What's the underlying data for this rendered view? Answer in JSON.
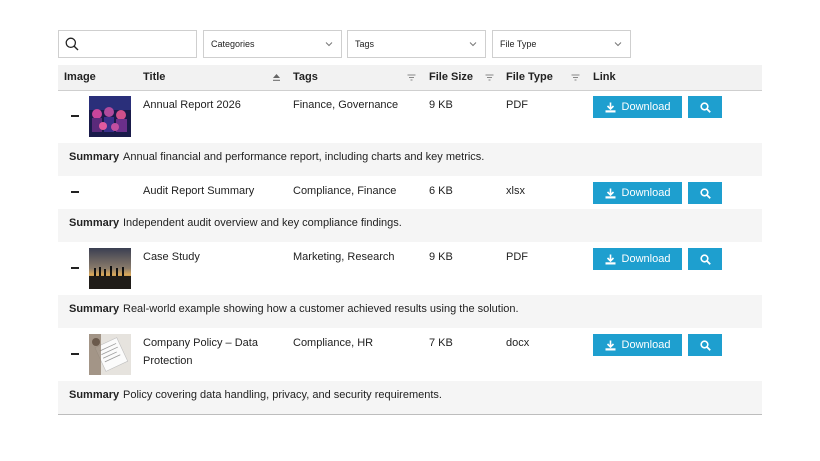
{
  "filters": {
    "search_placeholder": "",
    "categories_label": "Categories",
    "tags_label": "Tags",
    "file_type_label": "File Type"
  },
  "table": {
    "headers": {
      "image": "Image",
      "title": "Title",
      "tags": "Tags",
      "file_size": "File Size",
      "file_type": "File Type",
      "link": "Link"
    },
    "download_label": "Download",
    "summary_label": "Summary",
    "rows": [
      {
        "title": "Annual Report 2026",
        "tags": "Finance, Governance",
        "file_size": "9 KB",
        "file_type": "PDF",
        "has_image": true,
        "summary": "Annual financial and performance report, including charts and key metrics."
      },
      {
        "title": "Audit Report Summary",
        "tags": "Compliance, Finance",
        "file_size": "6 KB",
        "file_type": "xlsx",
        "has_image": false,
        "summary": "Independent audit overview and key compliance findings."
      },
      {
        "title": "Case Study",
        "tags": "Marketing, Research",
        "file_size": "9 KB",
        "file_type": "PDF",
        "has_image": true,
        "summary": "Real-world example showing how a customer achieved results using the solution."
      },
      {
        "title_line1": "Company Policy – Data",
        "title_line2": "Protection",
        "tags": "Compliance, HR",
        "file_size": "7 KB",
        "file_type": "docx",
        "has_image": true,
        "summary": "Policy covering data handling, privacy, and security requirements."
      }
    ]
  },
  "colors": {
    "accent": "#1e9fcf",
    "header_bg": "#f2f2f2",
    "summary_bg": "#f5f5f5"
  }
}
